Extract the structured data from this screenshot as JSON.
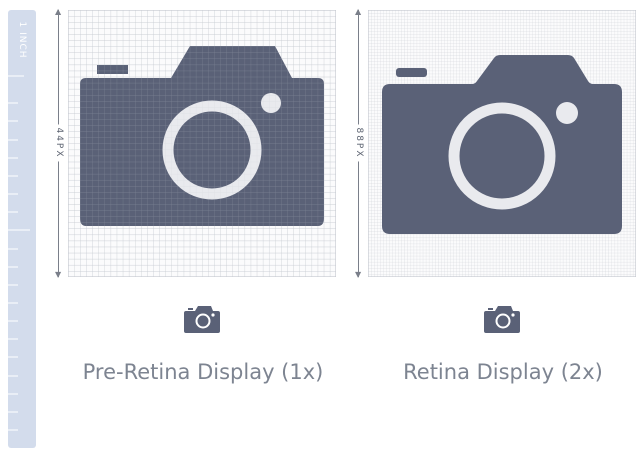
{
  "ruler": {
    "label": "1 INCH",
    "color": "#d3dcec"
  },
  "panel_1x": {
    "dimension_label": "44PX",
    "caption": "Pre-Retina Display (1x)",
    "icon": "camera-icon",
    "grid_cells": 44
  },
  "panel_2x": {
    "dimension_label": "88PX",
    "caption": "Retina Display (2x)",
    "icon": "camera-icon",
    "grid_cells": 88
  },
  "colors": {
    "camera": "#5a6177",
    "grid_line": "#c4c8cf",
    "caption_text": "#7d8491"
  }
}
